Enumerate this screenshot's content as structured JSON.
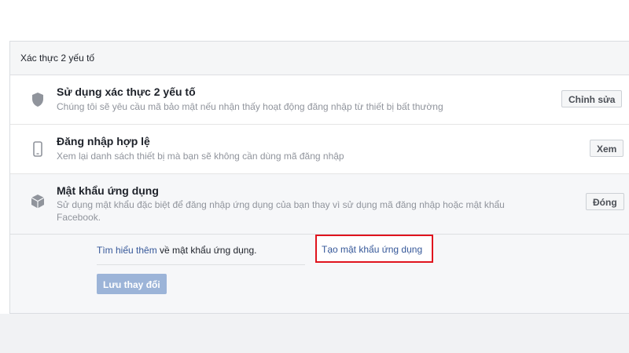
{
  "section": {
    "title": "Xác thực 2 yếu tố"
  },
  "rows": [
    {
      "title": "Sử dụng xác thực 2 yếu tố",
      "description": "Chúng tôi sẽ yêu cầu mã bảo mật nếu nhận thấy hoạt động đăng nhập từ thiết bị bất thường",
      "button": "Chỉnh sửa",
      "icon": "shield-icon"
    },
    {
      "title": "Đăng nhập hợp lệ",
      "description": "Xem lại danh sách thiết bị mà bạn sẽ không cần dùng mã đăng nhập",
      "button": "Xem",
      "icon": "phone-icon"
    },
    {
      "title": "Mật khẩu ứng dụng",
      "description": "Sử dụng mật khẩu đặc biệt để đăng nhập ứng dụng của bạn thay vì sử dụng mã đăng nhập hoặc mật khẩu Facebook.",
      "button": "Đóng",
      "icon": "cube-icon"
    }
  ],
  "expanded": {
    "learn_more_link": "Tìm hiểu thêm",
    "learn_more_text": " về mật khẩu ứng dụng.",
    "create_link": "Tạo mật khẩu ứng dụng",
    "save_button": "Lưu thay đổi"
  },
  "colors": {
    "link": "#365899",
    "highlight_border": "#e0141e",
    "disabled_button": "#9cb4d8"
  }
}
